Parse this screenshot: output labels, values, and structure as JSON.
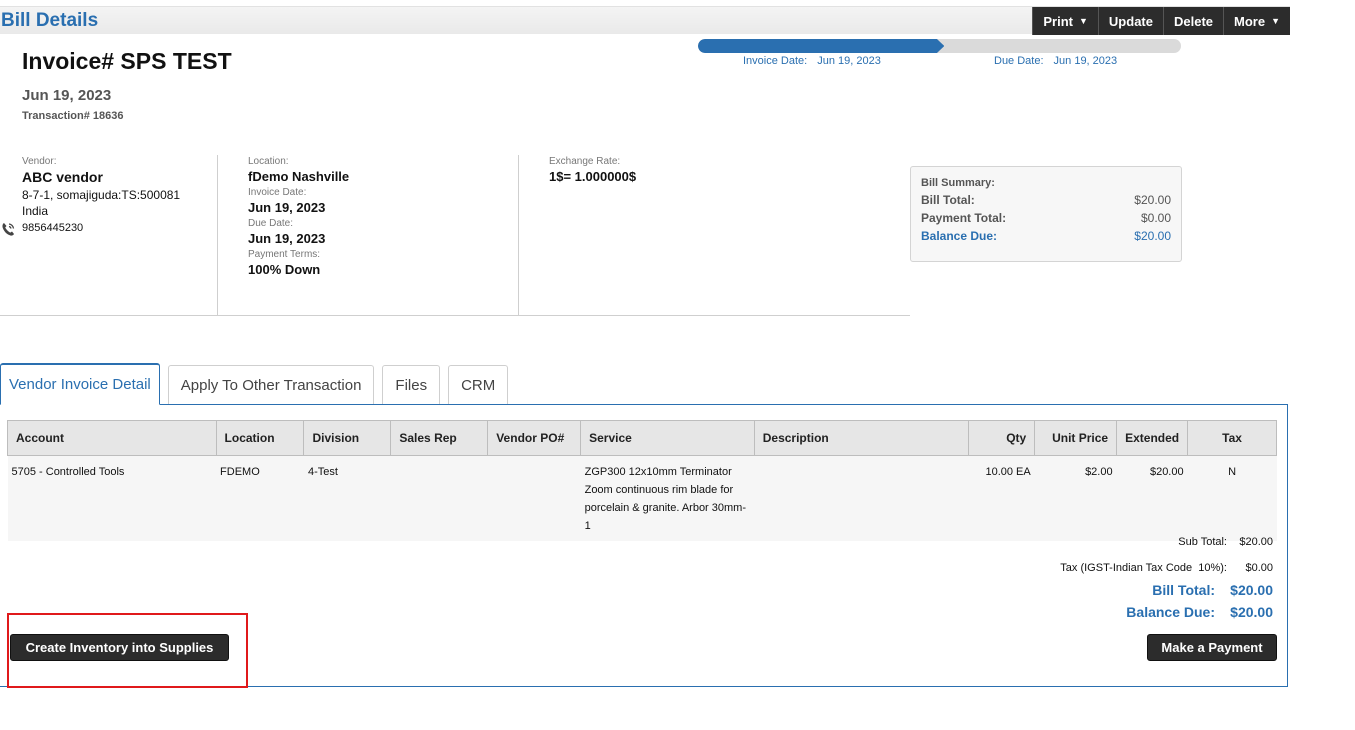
{
  "header": {
    "title": "Bill Details",
    "toolbar": [
      {
        "label": "Print",
        "dropdown": true
      },
      {
        "label": "Update",
        "dropdown": false
      },
      {
        "label": "Delete",
        "dropdown": false
      },
      {
        "label": "More",
        "dropdown": true
      }
    ]
  },
  "invoice": {
    "title": "Invoice# SPS TEST",
    "date": "Jun 19, 2023",
    "transaction": "Transaction# 18636"
  },
  "progress": {
    "fraction": 0.51,
    "invoice_date_label": "Invoice Date:",
    "invoice_date_value": "Jun 19, 2023",
    "due_date_label": "Due Date:",
    "due_date_value": "Jun 19, 2023"
  },
  "vendor": {
    "label": "Vendor:",
    "name": "ABC vendor",
    "address1": "8-7-1, somajiguda:TS:500081",
    "country": "India",
    "phone": "9856445230",
    "phone_icon": "phone-icon"
  },
  "details": {
    "location_label": "Location:",
    "location": "fDemo Nashville",
    "invoice_date_label": "Invoice Date:",
    "invoice_date": "Jun 19, 2023",
    "due_date_label": "Due Date:",
    "due_date": "Jun 19, 2023",
    "payment_terms_label": "Payment Terms:",
    "payment_terms": "100% Down"
  },
  "exchange": {
    "label": "Exchange Rate:",
    "value": "1$= 1.000000$"
  },
  "summary": {
    "title": "Bill Summary:",
    "bill_total_label": "Bill Total:",
    "bill_total": "$20.00",
    "payment_total_label": "Payment Total:",
    "payment_total": "$0.00",
    "balance_due_label": "Balance Due:",
    "balance_due": "$20.00"
  },
  "tabs": [
    {
      "label": "Vendor Invoice Detail",
      "active": true
    },
    {
      "label": "Apply To Other Transaction",
      "active": false
    },
    {
      "label": "Files",
      "active": false
    },
    {
      "label": "CRM",
      "active": false
    }
  ],
  "table": {
    "columns": [
      "Account",
      "Location",
      "Division",
      "Sales Rep",
      "Vendor PO#",
      "Service",
      "Description",
      "Qty",
      "Unit Price",
      "Extended",
      "Tax"
    ],
    "rows": [
      [
        "5705 - Controlled Tools",
        "FDEMO",
        "4-Test",
        "",
        "",
        "ZGP300 12x10mm Terminator Zoom continuous rim blade for porcelain & granite. Arbor 30mm-1",
        "",
        "10.00 EA",
        "$2.00",
        "$20.00",
        "N"
      ]
    ]
  },
  "totals": {
    "sub_total_label": "Sub Total:",
    "sub_total": "$20.00",
    "tax_label": "Tax (IGST-Indian Tax Code  10%):",
    "tax": "$0.00",
    "bill_total_label": "Bill Total:",
    "bill_total": "$20.00",
    "balance_due_label": "Balance Due:",
    "balance_due": "$20.00"
  },
  "actions": {
    "create_inventory": "Create Inventory into Supplies",
    "make_payment": "Make a Payment"
  },
  "colors": {
    "accent": "#2a6fb0",
    "dark_button": "#2c2c2c",
    "highlight": "#e0191b"
  }
}
